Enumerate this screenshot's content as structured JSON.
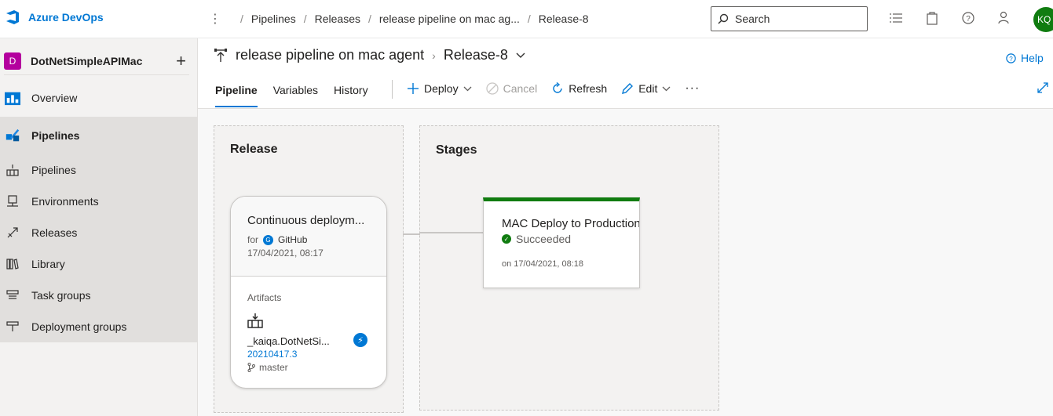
{
  "brand": {
    "name": "Azure DevOps"
  },
  "breadcrumb": [
    "Pipelines",
    "Releases",
    "release pipeline on mac ag...",
    "Release-8"
  ],
  "search": {
    "placeholder": "Search"
  },
  "user": {
    "initials": "KQ"
  },
  "project": {
    "badge": "D",
    "name": "DotNetSimpleAPIMac"
  },
  "sidebar": {
    "overview": "Overview",
    "pipelines_section": "Pipelines",
    "items": [
      "Pipelines",
      "Environments",
      "Releases",
      "Library",
      "Task groups",
      "Deployment groups"
    ]
  },
  "header": {
    "pipeline_name": "release pipeline on mac agent",
    "release_name": "Release-8",
    "help": "Help"
  },
  "tabs": [
    "Pipeline",
    "Variables",
    "History"
  ],
  "toolbar": {
    "deploy": "Deploy",
    "cancel": "Cancel",
    "refresh": "Refresh",
    "edit": "Edit",
    "more": "···"
  },
  "release_panel": {
    "title": "Release",
    "trigger_name": "Continuous deploym...",
    "for_label": "for",
    "source": "GitHub",
    "date": "17/04/2021, 08:17",
    "artifacts_label": "Artifacts",
    "artifact_name": "_kaiqa.DotNetSi...",
    "build": "20210417.3",
    "branch": "master"
  },
  "stages_panel": {
    "title": "Stages",
    "stage_name": "MAC Deploy to Production",
    "status": "Succeeded",
    "date": "on 17/04/2021, 08:18"
  },
  "colors": {
    "accent": "#0078d4",
    "success": "#107c10",
    "project_badge": "#b4009e"
  }
}
